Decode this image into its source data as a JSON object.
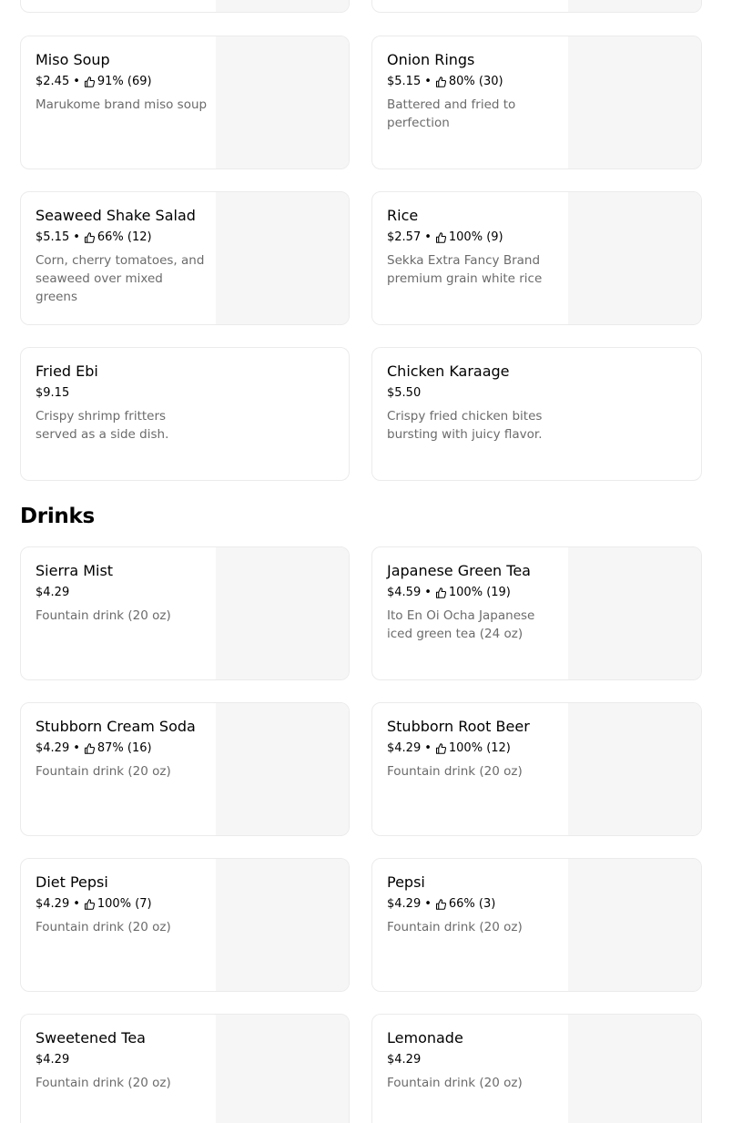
{
  "sides": {
    "items": [
      {
        "name": "Miso Soup",
        "price": "$2.45",
        "rating": "91% (69)",
        "desc": "Marukome brand miso soup"
      },
      {
        "name": "Onion Rings",
        "price": "$5.15",
        "rating": "80% (30)",
        "desc": "Battered and fried to perfection"
      },
      {
        "name": "Seaweed Shake Salad",
        "price": "$5.15",
        "rating": "66% (12)",
        "desc": "Corn, cherry tomatoes, and seaweed over mixed greens"
      },
      {
        "name": "Rice",
        "price": "$2.57",
        "rating": "100% (9)",
        "desc": "Sekka Extra Fancy Brand premium grain white rice"
      },
      {
        "name": "Fried Ebi",
        "price": "$9.15",
        "desc": "Crispy shrimp fritters served as a side dish."
      },
      {
        "name": "Chicken Karaage",
        "price": "$5.50",
        "desc": "Crispy fried chicken bites bursting with juicy flavor."
      }
    ]
  },
  "drinks": {
    "title": "Drinks",
    "items": [
      {
        "name": "Sierra Mist",
        "price": "$4.29",
        "desc": "Fountain drink (20 oz)"
      },
      {
        "name": "Japanese Green Tea",
        "price": "$4.59",
        "rating": "100% (19)",
        "desc": "Ito En Oi Ocha Japanese iced green tea (24 oz)"
      },
      {
        "name": "Stubborn Cream Soda",
        "price": "$4.29",
        "rating": "87% (16)",
        "desc": "Fountain drink (20 oz)"
      },
      {
        "name": "Stubborn Root Beer",
        "price": "$4.29",
        "rating": "100% (12)",
        "desc": "Fountain drink (20 oz)"
      },
      {
        "name": "Diet Pepsi",
        "price": "$4.29",
        "rating": "100% (7)",
        "desc": "Fountain drink (20 oz)"
      },
      {
        "name": "Pepsi",
        "price": "$4.29",
        "rating": "66% (3)",
        "desc": "Fountain drink (20 oz)"
      },
      {
        "name": "Sweetened Tea",
        "price": "$4.29",
        "desc": "Fountain drink (20 oz)"
      },
      {
        "name": "Lemonade",
        "price": "$4.29",
        "desc": "Fountain drink (20 oz)"
      }
    ]
  },
  "icons": {
    "rating": "thumbs-up-icon",
    "separator": "•"
  },
  "colors": {
    "card_border": "#ebebeb",
    "thumb_bg": "#f6f6f6",
    "desc_text": "#6b6b6b"
  }
}
